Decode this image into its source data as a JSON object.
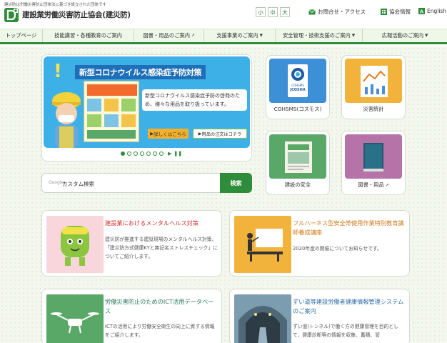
{
  "header": {
    "top_note": "建災防は労働災害防止団体法に基づき設立された団体です",
    "site_name": "建設業労働災害防止協会(建災防)",
    "font_sizes": [
      "小",
      "中",
      "大"
    ],
    "links": {
      "contact": "お問合せ・アクセス",
      "info": "協会情報",
      "english": "English"
    }
  },
  "nav": {
    "items": [
      {
        "label": "トップページ"
      },
      {
        "label": "技能講習・各種教育のご案内"
      },
      {
        "label": "図書・用品のご案内"
      },
      {
        "label": "支援事業のご案内"
      },
      {
        "label": "安全管理・技術支援のご案内"
      },
      {
        "label": "広報活動のご案内"
      }
    ]
  },
  "slider": {
    "title": "新型コロナウイルス感染症予防対策",
    "text": "新型コロナウイルス感染症予防の啓発のため、様々な用品を取り扱っています。",
    "button_details": "詳しくはこちら",
    "button_order": "用品の注文はコチラ",
    "slide_count": 7,
    "active_slide": 1
  },
  "tiles": [
    {
      "label": "COHSMS(コスモス)",
      "logo_text": "COHSMS",
      "logo_sub": "JCOSHA",
      "color": "#3d8fd6"
    },
    {
      "label": "災害統計",
      "color": "#f2b33c"
    },
    {
      "label": "建設の安全",
      "color": "#5aa867"
    },
    {
      "label": "図書・用品",
      "color": "#b673a8"
    }
  ],
  "search": {
    "placeholder": "カスタム検索",
    "brand": "Google",
    "button": "検索"
  },
  "cards": [
    {
      "title": "建設業におけるメンタルヘルス対策",
      "body": "建災防が推進する建設現場のメンタルヘルス対策、「建災防方式健康KYと無記名ストレスチェック」についてご紹介します。"
    },
    {
      "title": "フルハーネス型安全帯使用作業特別教育講師養成講座",
      "body": "2020年度の開催についてお知らせです。"
    },
    {
      "title": "労働災害防止のためのICT活用データベース",
      "body": "ICTの活用により労働安全衛生の向上に資する情報をご紹介します。"
    },
    {
      "title": "ずい道等建設労働者健康情報管理システムのご案内",
      "body": "ずい道(トンネル)で働く方の健康管理を目的として、健康診断等の情報を収集、蓄積、管"
    }
  ]
}
